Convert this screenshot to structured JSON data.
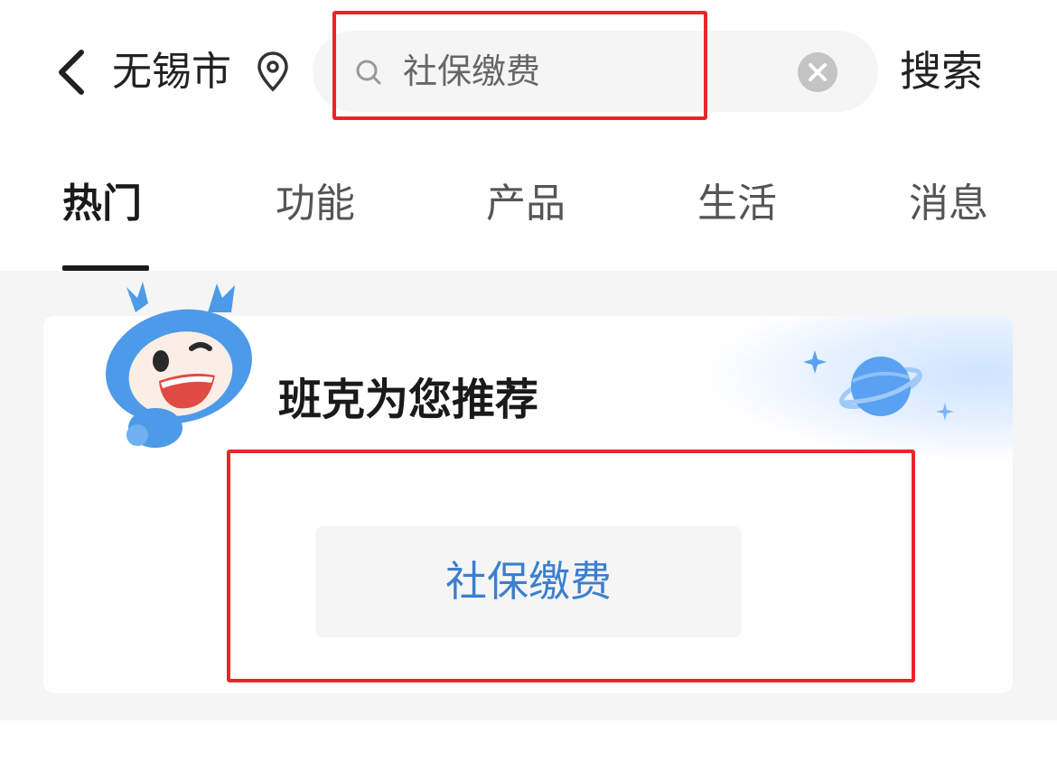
{
  "header": {
    "city": "无锡市",
    "search_value": "社保缴费",
    "search_button": "搜索",
    "icons": [
      "back-arrow-icon",
      "location-pin-icon",
      "search-icon",
      "clear-icon"
    ]
  },
  "tabs": [
    {
      "label": "热门",
      "active": true
    },
    {
      "label": "功能",
      "active": false
    },
    {
      "label": "产品",
      "active": false
    },
    {
      "label": "生活",
      "active": false
    },
    {
      "label": "消息",
      "active": false
    }
  ],
  "recommend": {
    "title": "班克为您推荐",
    "items": [
      {
        "label": "社保缴费"
      }
    ]
  },
  "colors": {
    "accent": "#3b7fcf",
    "highlight": "#e8262a",
    "background": "#f5f5f5"
  }
}
